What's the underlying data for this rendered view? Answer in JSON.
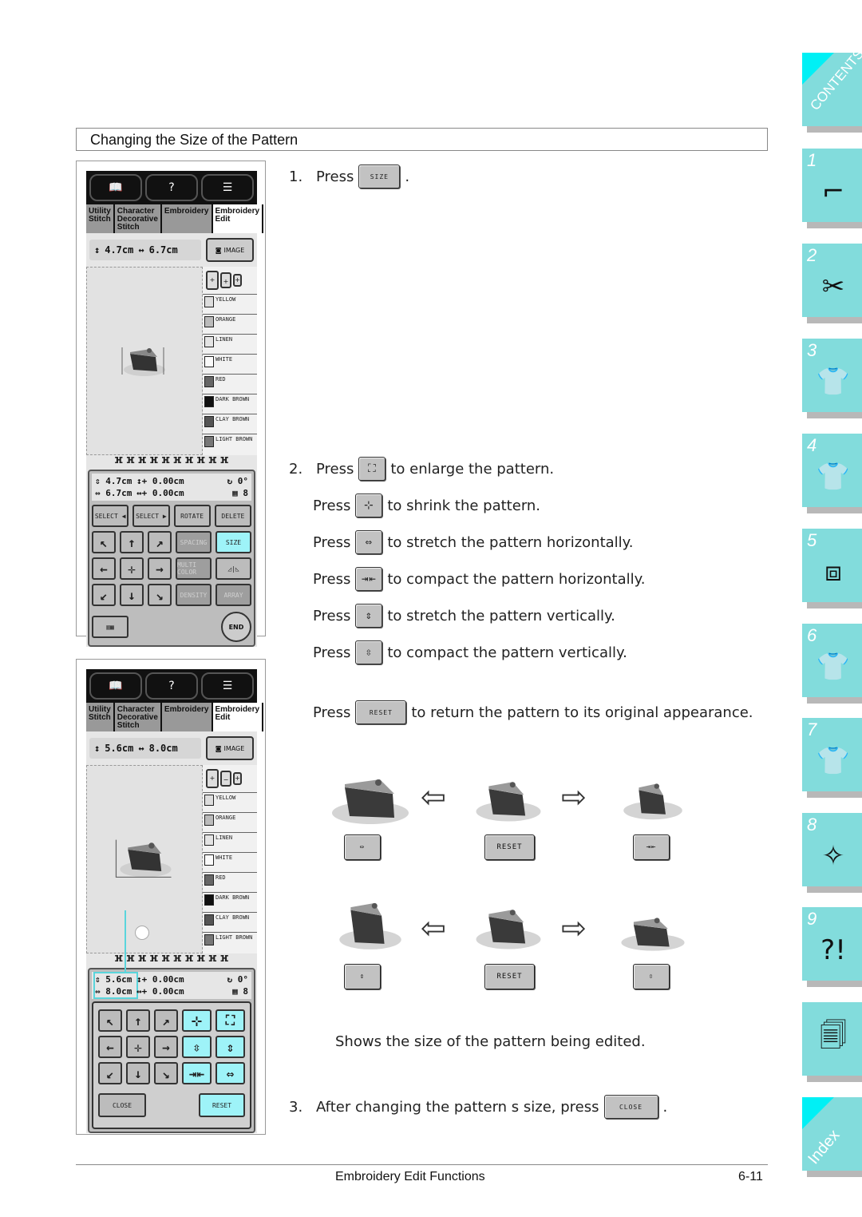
{
  "section_title": "Changing the Size of the Pattern",
  "screen1": {
    "tabs": [
      "Utility Stitch",
      "Character Decorative Stitch",
      "Embroidery",
      "Embroidery Edit"
    ],
    "height": "4.7cm",
    "width": "6.7cm",
    "image_button": "IMAGE",
    "threads": [
      "YELLOW",
      "ORANGE",
      "LINEN",
      "WHITE",
      "RED",
      "DARK BROWN",
      "CLAY BROWN",
      "LIGHT BROWN"
    ],
    "thread_colors": [
      "#d0d0d0",
      "#b0b0b0",
      "#dadada",
      "#f4f4f4",
      "#6a6a6a",
      "#111111",
      "#5a5a5a",
      "#777777"
    ],
    "readout": {
      "h": "4.7cm",
      "w": "6.7cm",
      "dy": "0.00cm",
      "dx": "0.00cm",
      "angle": "0°",
      "colors": "8"
    },
    "buttons": {
      "select_left": "SELECT ◀",
      "select_right": "SELECT ▶",
      "rotate": "ROTATE",
      "delete": "DELETE",
      "spacing": "SPACING",
      "size": "SIZE",
      "multi_color": "MULTI COLOR",
      "mirror": "◿|◺",
      "density": "DENSITY",
      "array": "ARRAY",
      "end": "END"
    }
  },
  "screen2": {
    "tabs": [
      "Utility Stitch",
      "Character Decorative Stitch",
      "Embroidery",
      "Embroidery Edit"
    ],
    "height": "5.6cm",
    "width": "8.0cm",
    "image_button": "IMAGE",
    "threads": [
      "YELLOW",
      "ORANGE",
      "LINEN",
      "WHITE",
      "RED",
      "DARK BROWN",
      "CLAY BROWN",
      "LIGHT BROWN"
    ],
    "readout": {
      "h": "5.6cm",
      "w": "8.0cm",
      "dy": "0.00cm",
      "dx": "0.00cm",
      "angle": "0°",
      "colors": "8"
    },
    "buttons": {
      "close": "CLOSE",
      "reset": "RESET"
    }
  },
  "steps": {
    "s1_num": "1.",
    "s1_text": "Press",
    "s1_btn": "SIZE",
    "s2_num": "2.",
    "press": "Press",
    "enlarge": "to enlarge the pattern.",
    "shrink": "to shrink the pattern.",
    "stretch_h": "to stretch the pattern horizontally.",
    "compact_h": "to compact the pattern horizontally.",
    "stretch_v": "to stretch the pattern vertically.",
    "compact_v": "to compact the pattern vertically.",
    "reset_btn": "RESET",
    "reset_text": "to return the pattern to its original appearance.",
    "caption": "Shows the size of the pattern being edited.",
    "s3_num": "3.",
    "s3_text": "After changing the pattern s size, press",
    "close_btn": "CLOSE"
  },
  "examples": {
    "reset": "RESET"
  },
  "footer": {
    "title": "Embroidery Edit Functions",
    "page": "6-11"
  },
  "sidetabs": [
    {
      "label": "CONTENTS",
      "icon": "contents"
    },
    {
      "label": "1",
      "icon": "sewing-machine-hand-icon"
    },
    {
      "label": "2",
      "icon": "thread-scissors-icon"
    },
    {
      "label": "3",
      "icon": "shirt-icon"
    },
    {
      "label": "4",
      "icon": "shirt-abc-icon"
    },
    {
      "label": "5",
      "icon": "hoop-star-icon"
    },
    {
      "label": "6",
      "icon": "shirt-monogram-icon"
    },
    {
      "label": "7",
      "icon": "shirt-pen-icon"
    },
    {
      "label": "8",
      "icon": "machine-sparkle-icon"
    },
    {
      "label": "9",
      "icon": "machine-question-icon"
    },
    {
      "label": "",
      "icon": "documents-icon"
    },
    {
      "label": "Index",
      "icon": "index"
    }
  ],
  "accent_color": "#82dcdc"
}
